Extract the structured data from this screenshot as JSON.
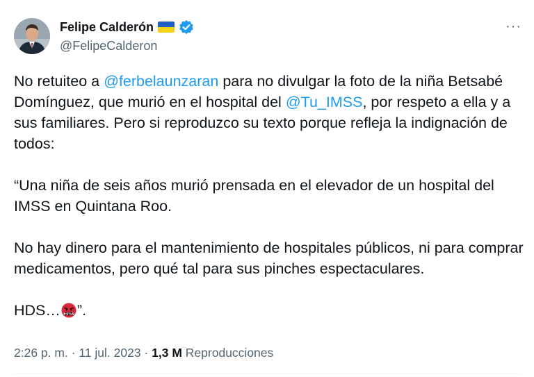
{
  "author": {
    "name": "Felipe Calderón",
    "handle": "@FelipeCalderon"
  },
  "menu": {
    "more_label": "···"
  },
  "tweet": {
    "p1": {
      "t1": "No retuiteo a ",
      "m1": "@ferbelaunzaran",
      "t2": " para no divulgar la foto de la niña Betsabé Domínguez, que murió en el hospital del ",
      "m2": "@Tu_IMSS",
      "t3": ", por respeto a ella y a sus familiares. Pero si reproduzco su texto porque refleja la indignación de todos:"
    },
    "p2": "“Una niña de seis años murió prensada en el elevador de un hospital del IMSS en Quintana Roo.",
    "p3": "No hay dinero para el mantenimiento de hospitales públicos, ni para comprar medicamentos, pero qué tal para sus pinches espectaculares.",
    "p4": {
      "before": "HDS…",
      "after": "”."
    }
  },
  "meta": {
    "time": "2:26 p. m.",
    "sep1": " · ",
    "date": "11 jul. 2023",
    "sep2": " · ",
    "views": "1,3 M",
    "views_label": " Reproducciones"
  },
  "colors": {
    "link": "#1d9bf0",
    "text": "#0f1419",
    "secondary": "#536471",
    "verified": "#1d9bf0"
  },
  "icons": {
    "flag": "ukraine-flag-icon",
    "verified": "verified-badge-icon",
    "emoji": "angry-cursing-face-icon"
  }
}
